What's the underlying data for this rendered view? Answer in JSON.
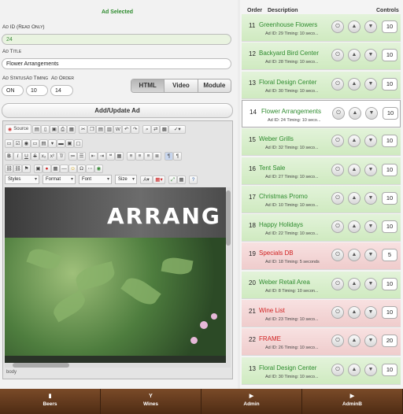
{
  "form": {
    "heading": "Ad Selected",
    "ad_id_label": "Ad ID (Read Only)",
    "ad_id_value": "24",
    "ad_title_label": "Ad Title",
    "ad_title_value": "Flower Arrangements",
    "ad_status_label": "Ad Status",
    "ad_timing_label": "Ad Timing",
    "ad_order_label": "Ad Order",
    "ad_status_value": "ON",
    "ad_timing_value": "10",
    "ad_order_value": "14",
    "add_update_label": "Add/Update Ad"
  },
  "mode_tabs": [
    "HTML",
    "Video",
    "Module"
  ],
  "editor": {
    "source_label": "Source",
    "styles_label": "Styles",
    "format_label": "Format",
    "font_label": "Font",
    "size_label": "Size",
    "status_path": "body",
    "banner_text": "ARRANG"
  },
  "list": {
    "col_order": "Order",
    "col_description": "Description",
    "col_controls": "Controls",
    "rows": [
      {
        "num": "11",
        "title": "Greenhouse Flowers",
        "sub": "Ad ID: 29 Timing: 10 seco...",
        "order": "10",
        "state": "g"
      },
      {
        "num": "12",
        "title": "Backyard Bird Center",
        "sub": "Ad ID: 28 Timing: 10 seco...",
        "order": "10",
        "state": "g"
      },
      {
        "num": "13",
        "title": "Floral Design Center",
        "sub": "Ad ID: 30 Timing: 10 seco...",
        "order": "10",
        "state": "g"
      },
      {
        "num": "14",
        "title": "Flower Arrangements",
        "sub": "Ad ID: 24 Timing: 10 seco...",
        "order": "10",
        "state": "sel"
      },
      {
        "num": "15",
        "title": "Weber Grills",
        "sub": "Ad ID: 32 Timing: 10 seco...",
        "order": "10",
        "state": "g"
      },
      {
        "num": "16",
        "title": "Tent Sale",
        "sub": "Ad ID: 27 Timing: 10 seco...",
        "order": "10",
        "state": "g"
      },
      {
        "num": "17",
        "title": "Christmas Promo",
        "sub": "Ad ID: 10 Timing: 10 seco...",
        "order": "10",
        "state": "g"
      },
      {
        "num": "18",
        "title": "Happy Holidays",
        "sub": "Ad ID: 22 Timing: 10 seco...",
        "order": "10",
        "state": "g"
      },
      {
        "num": "19",
        "title": "Specials DB",
        "sub": "Ad ID: 18 Timing: 5 seconds",
        "order": "5",
        "state": "r"
      },
      {
        "num": "20",
        "title": "Weber Retail Area",
        "sub": "Ad ID: 8 Timing: 10 secon...",
        "order": "10",
        "state": "g"
      },
      {
        "num": "21",
        "title": "Wine List",
        "sub": "Ad ID: 23 Timing: 10 seco...",
        "order": "10",
        "state": "r"
      },
      {
        "num": "22",
        "title": "FRAME",
        "sub": "Ad ID: 26 Timing: 10 seco...",
        "order": "20",
        "state": "r"
      },
      {
        "num": "13",
        "title": "Floral Design Center",
        "sub": "Ad ID: 30 Timing: 10 seco...",
        "order": "10",
        "state": "g"
      }
    ]
  },
  "tabs": [
    {
      "label": "Beers",
      "icon": "beer-icon"
    },
    {
      "label": "Wines",
      "icon": "wine-glass-icon"
    },
    {
      "label": "Admin",
      "icon": "play-icon"
    },
    {
      "label": "AdminB",
      "icon": "play-icon"
    }
  ],
  "colors": {
    "active_title": "#2e8b2e",
    "inactive_title": "#d02020",
    "tabbar": "#5e3519"
  }
}
